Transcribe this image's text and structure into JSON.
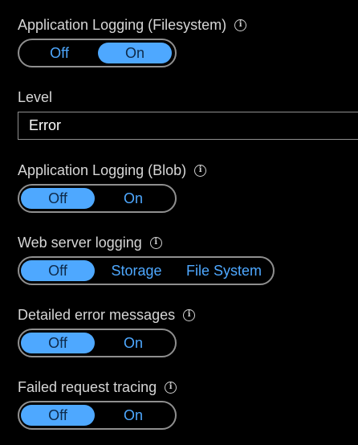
{
  "sections": {
    "app_logging_fs": {
      "label": "Application Logging (Filesystem)",
      "options": [
        "Off",
        "On"
      ],
      "selected": "On"
    },
    "level": {
      "label": "Level",
      "value": "Error"
    },
    "app_logging_blob": {
      "label": "Application Logging (Blob)",
      "options": [
        "Off",
        "On"
      ],
      "selected": "Off"
    },
    "web_server_logging": {
      "label": "Web server logging",
      "options": [
        "Off",
        "Storage",
        "File System"
      ],
      "selected": "Off"
    },
    "detailed_errors": {
      "label": "Detailed error messages",
      "options": [
        "Off",
        "On"
      ],
      "selected": "Off"
    },
    "failed_request_tracing": {
      "label": "Failed request tracing",
      "options": [
        "Off",
        "On"
      ],
      "selected": "Off"
    }
  },
  "icons": {
    "info": "info-icon",
    "info_glyph": "i"
  },
  "colors": {
    "background": "#000000",
    "text": "#d6d6d6",
    "accent": "#4ea8ff",
    "border": "#8f8f8f",
    "selected_text": "#0e2a4a"
  }
}
